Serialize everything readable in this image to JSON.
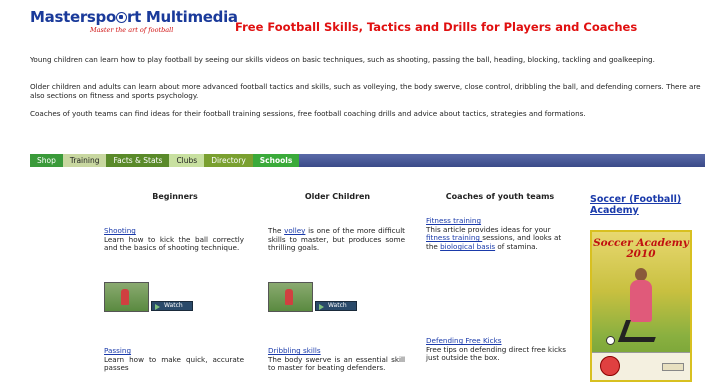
{
  "header": {
    "logo_pre": "Masterspo",
    "logo_post": "rt Multimedia",
    "tagline": "Master the art of football",
    "title": "Free Football Skills, Tactics and Drills for Players and Coaches"
  },
  "intro": [
    "Young children can learn how to play football by seeing our skills videos on basic techniques, such as shooting, passing the ball, heading, blocking, tackling and goalkeeping.",
    "Older children and adults can learn about more advanced football tactics and skills, such as volleying, the body swerve, close control, dribbling the ball, and defending corners. There are also sections on fitness and sports psychology.",
    "Coaches of youth teams can find ideas for their football training sessions, free football coaching drills and advice about tactics, strategies and formations."
  ],
  "nav": {
    "shop": "Shop",
    "training": "Training",
    "facts": "Facts & Stats",
    "clubs": "Clubs",
    "directory": "Directory",
    "schools": "Schools"
  },
  "columns": {
    "beginners": {
      "heading": "Beginners",
      "shooting_title": "Shooting",
      "shooting_desc": "Learn how to kick the ball correctly and the basics of shooting technique.",
      "passing_title": "Passing",
      "passing_desc": "Learn how to make quick, accurate passes"
    },
    "older": {
      "heading": "Older Children",
      "volley_pre": "The ",
      "volley_link": "volley",
      "volley_post": " is one of the more difficult skills to master, but produces some thrilling goals.",
      "dribbling_title": "Dribbling skills",
      "dribbling_desc": "The body swerve is an essential skill to master for beating defenders."
    },
    "coaches": {
      "heading": "Coaches of youth teams",
      "fitness_title": "Fitness training",
      "fitness_pre": "This article provides ideas for your ",
      "fitness_link": "fitness training ",
      "fitness_mid": "sessions, and looks at the ",
      "bio_link": "biological basis",
      "fitness_post": " of stamina.",
      "freekick_title": "Defending Free Kicks",
      "freekick_desc": "Free tips on defending direct free kicks just outside the box."
    }
  },
  "watch_label": "Watch",
  "academy": {
    "title": "Soccer (Football) Academy",
    "cover_line1": "Soccer Academy",
    "cover_line2": "2010"
  }
}
